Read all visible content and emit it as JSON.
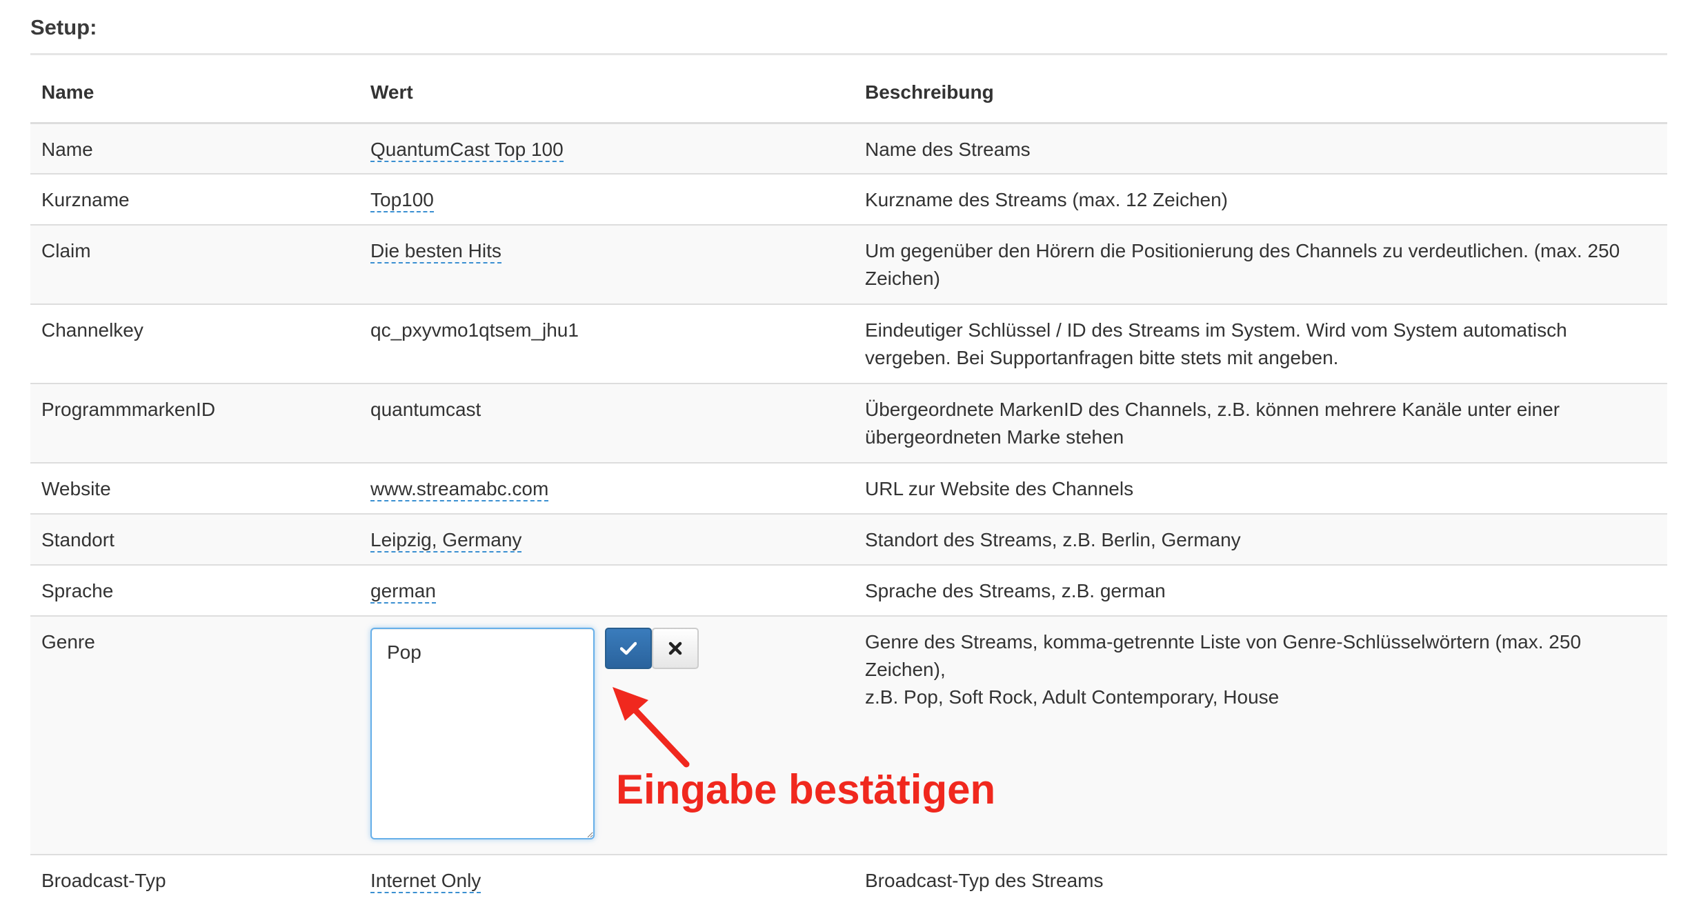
{
  "section": {
    "title": "Setup:"
  },
  "table": {
    "headers": {
      "name": "Name",
      "value": "Wert",
      "description": "Beschreibung"
    },
    "rows": [
      {
        "name": "Name",
        "value": "QuantumCast Top 100",
        "editable": true,
        "description": "Name des Streams"
      },
      {
        "name": "Kurzname",
        "value": "Top100",
        "editable": true,
        "description": "Kurzname des Streams (max. 12 Zeichen)"
      },
      {
        "name": "Claim",
        "value": "Die besten Hits",
        "editable": true,
        "description": "Um gegenüber den Hörern die Positionierung des Channels zu verdeutlichen. (max. 250 Zeichen)"
      },
      {
        "name": "Channelkey",
        "value": "qc_pxyvmo1qtsem_jhu1",
        "editable": false,
        "description": "Eindeutiger Schlüssel / ID des Streams im System. Wird vom System automatisch vergeben. Bei Supportanfragen bitte stets mit angeben."
      },
      {
        "name": "ProgrammmarkenID",
        "value": "quantumcast",
        "editable": false,
        "description": "Übergeordnete MarkenID des Channels, z.B. können mehrere Kanäle unter einer übergeordneten Marke stehen"
      },
      {
        "name": "Website",
        "value": "www.streamabc.com",
        "editable": true,
        "description": "URL zur Website des Channels"
      },
      {
        "name": "Standort",
        "value": "Leipzig, Germany",
        "editable": true,
        "description": "Standort des Streams, z.B. Berlin, Germany"
      },
      {
        "name": "Sprache",
        "value": "german",
        "editable": true,
        "description": "Sprache des Streams, z.B. german"
      },
      {
        "name": "Genre",
        "value": "Pop",
        "editable": true,
        "description_line1": "Genre des Streams, komma-getrennte Liste von Genre-Schlüsselwörtern (max. 250 Zeichen),",
        "description_line2": "z.B. Pop, Soft Rock, Adult Contemporary, House"
      },
      {
        "name": "Broadcast-Typ",
        "value": "Internet Only",
        "editable": true,
        "description": "Broadcast-Typ des Streams"
      }
    ]
  },
  "genre_editor": {
    "current_value": "Pop",
    "confirm_icon": "checkmark-icon",
    "cancel_icon": "close-icon"
  },
  "annotation": {
    "text": "Eingabe bestätigen",
    "color": "#f0281e"
  },
  "colors": {
    "primary_button": "#2f6ea8",
    "editable_underline": "#3a8fd1",
    "focus_border": "#66afe9",
    "stripe": "#f9f9f9"
  }
}
